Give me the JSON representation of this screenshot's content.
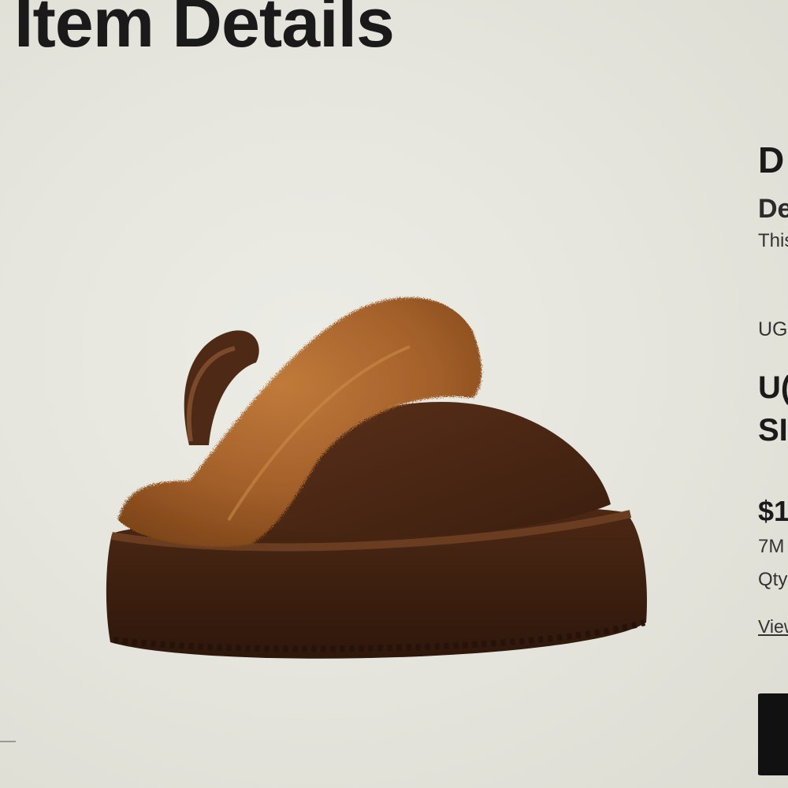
{
  "page": {
    "title": "Item Details"
  },
  "details": {
    "title": "D",
    "subtitle": "De",
    "description": "This",
    "brand": "UG",
    "name_line1": "U(",
    "name_line2": "SI",
    "price": "$1",
    "size": "7M",
    "qty": "Qty",
    "view_link": "View"
  },
  "product_image": {
    "alt": "brown platform slipper with fur collar and back strap"
  },
  "colors": {
    "background": "#e6e6de",
    "text": "#1a1a1a",
    "fur": "#a8642a",
    "suede": "#4a2616",
    "button": "#111111"
  }
}
